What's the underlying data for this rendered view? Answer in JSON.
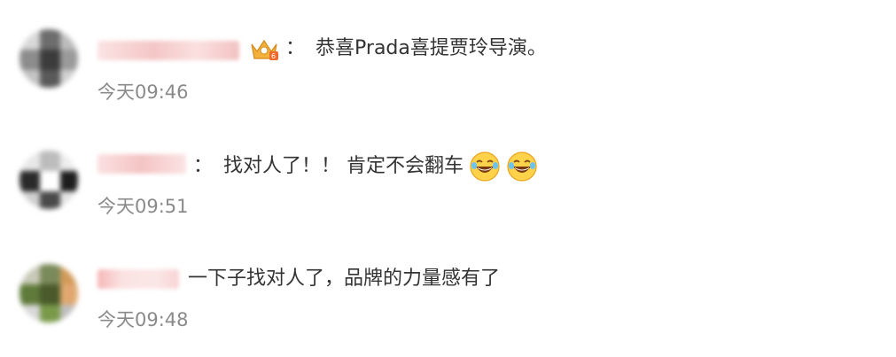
{
  "comments": [
    {
      "content": "恭喜Prada喜提贾玲导演。",
      "time": "今天09:46",
      "separator": "：",
      "has_badge": true,
      "emojis": []
    },
    {
      "content": "找对人了！！ 肯定不会翻车",
      "time": "今天09:51",
      "separator": "：",
      "has_badge": false,
      "emojis": [
        "laughing-tears-icon",
        "laughing-tears-icon"
      ]
    },
    {
      "content": "一下子找对人了，品牌的力量感有了",
      "time": "今天09:48",
      "separator": "",
      "has_badge": false,
      "emojis": []
    }
  ],
  "colors": {
    "text": "#333333",
    "time": "#8a8a8a",
    "username_blur": "#f6c9c9",
    "badge": "#f0a830"
  }
}
